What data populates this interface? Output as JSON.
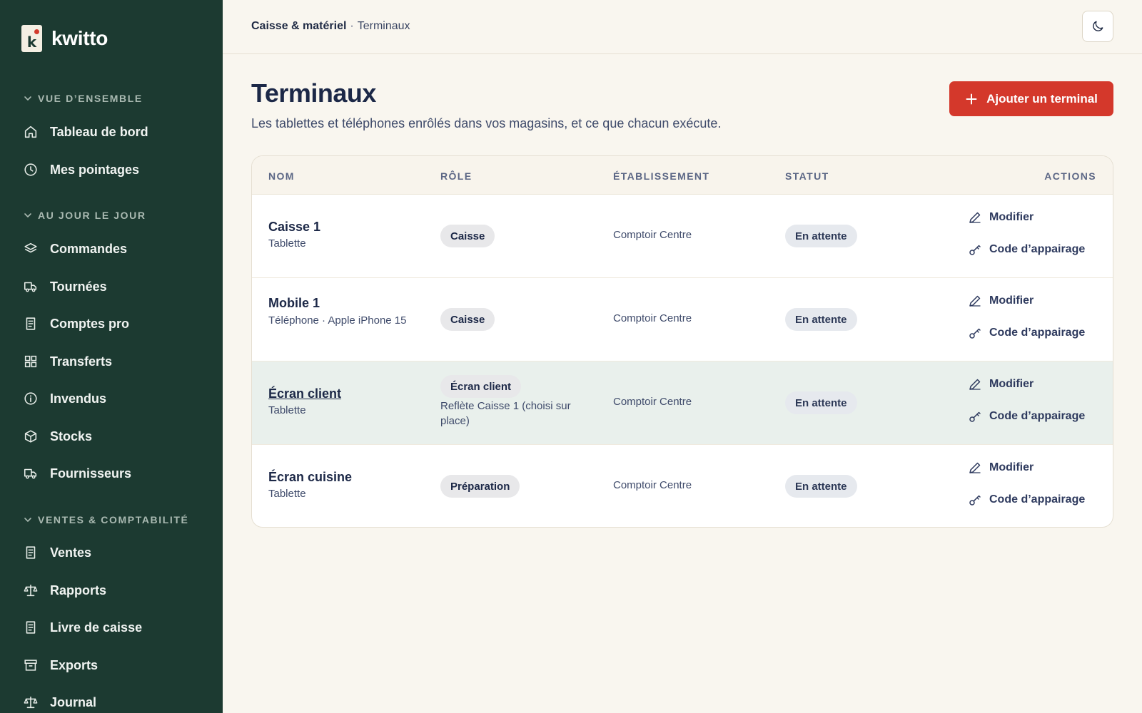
{
  "brand": {
    "name": "kwitto",
    "logo_letter": "k"
  },
  "sidebar": {
    "sections": [
      {
        "label": "VUE D’ENSEMBLE",
        "items": [
          {
            "label": "Tableau de bord",
            "icon": "home-icon"
          },
          {
            "label": "Mes pointages",
            "icon": "clock-icon"
          }
        ]
      },
      {
        "label": "AU JOUR LE JOUR",
        "items": [
          {
            "label": "Commandes",
            "icon": "layers-icon"
          },
          {
            "label": "Tournées",
            "icon": "truck-icon"
          },
          {
            "label": "Comptes pro",
            "icon": "receipt-icon"
          },
          {
            "label": "Transferts",
            "icon": "grid-icon"
          },
          {
            "label": "Invendus",
            "icon": "info-icon"
          },
          {
            "label": "Stocks",
            "icon": "box-icon"
          },
          {
            "label": "Fournisseurs",
            "icon": "truck-icon"
          }
        ]
      },
      {
        "label": "VENTES & COMPTABILITÉ",
        "items": [
          {
            "label": "Ventes",
            "icon": "receipt-icon"
          },
          {
            "label": "Rapports",
            "icon": "scale-icon"
          },
          {
            "label": "Livre de caisse",
            "icon": "receipt-icon"
          },
          {
            "label": "Exports",
            "icon": "archive-icon"
          },
          {
            "label": "Journal",
            "icon": "scale-icon"
          }
        ]
      }
    ]
  },
  "breadcrumb": {
    "parent": "Caisse & matériel",
    "separator": "·",
    "current": "Terminaux"
  },
  "header": {
    "title": "Terminaux",
    "subtitle": "Les tablettes et téléphones enrôlés dans vos magasins, et ce que chacun exécute.",
    "add_button": "Ajouter un terminal"
  },
  "table": {
    "columns": [
      "NOM",
      "RÔLE",
      "ÉTABLISSEMENT",
      "STATUT",
      "ACTIONS"
    ],
    "rows": [
      {
        "name": "Caisse 1",
        "device": "Tablette",
        "role": "Caisse",
        "role_note": "",
        "establishment": "Comptoir Centre",
        "status": "En attente"
      },
      {
        "name": "Mobile 1",
        "device": "Téléphone · Apple iPhone 15",
        "role": "Caisse",
        "role_note": "",
        "establishment": "Comptoir Centre",
        "status": "En attente"
      },
      {
        "name": "Écran client",
        "device": "Tablette",
        "role": "Écran client",
        "role_note": "Reflète Caisse 1 (choisi sur place)",
        "establishment": "Comptoir Centre",
        "status": "En attente"
      },
      {
        "name": "Écran cuisine",
        "device": "Tablette",
        "role": "Préparation",
        "role_note": "",
        "establishment": "Comptoir Centre",
        "status": "En attente"
      }
    ],
    "actions": {
      "edit": "Modifier",
      "pair": "Code d’appairage"
    }
  },
  "colors": {
    "sidebar": "#1c3a31",
    "accent": "#d4382b",
    "background": "#f9f6ef",
    "highlight_row": "#e9f0ec"
  }
}
